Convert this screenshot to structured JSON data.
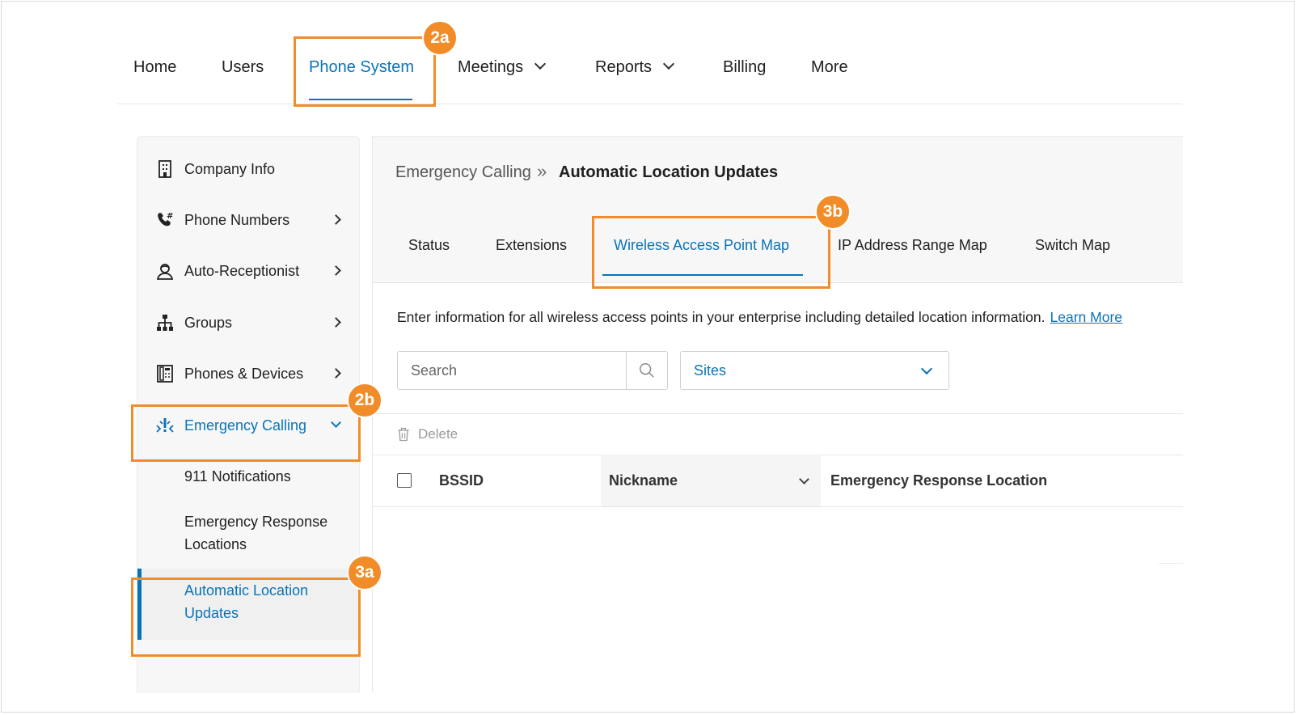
{
  "topnav": {
    "items": [
      "Home",
      "Users",
      "Phone System",
      "Meetings",
      "Reports",
      "Billing",
      "More"
    ],
    "active": "Phone System"
  },
  "sidebar": {
    "items": [
      {
        "label": "Company Info",
        "icon": "building-icon"
      },
      {
        "label": "Phone Numbers",
        "icon": "phone-hash-icon"
      },
      {
        "label": "Auto-Receptionist",
        "icon": "receptionist-icon"
      },
      {
        "label": "Groups",
        "icon": "org-chart-icon"
      },
      {
        "label": "Phones & Devices",
        "icon": "desk-phone-icon"
      },
      {
        "label": "Emergency Calling",
        "icon": "emergency-icon"
      }
    ],
    "subitems": [
      "911 Notifications",
      "Emergency Response Locations",
      "Automatic Location Updates"
    ]
  },
  "breadcrumb": {
    "parent": "Emergency Calling",
    "separator": "»",
    "current": "Automatic Location Updates"
  },
  "tabs": [
    "Status",
    "Extensions",
    "Wireless Access Point Map",
    "IP Address Range Map",
    "Switch Map"
  ],
  "active_tab": "Wireless Access Point Map",
  "description": "Enter information for all wireless access points in your enterprise including detailed location information.",
  "learn_more": "Learn More",
  "search": {
    "placeholder": "Search"
  },
  "sites": {
    "value": "Sites"
  },
  "toolbar": {
    "delete_label": "Delete"
  },
  "table": {
    "columns": [
      "BSSID",
      "Nickname",
      "Emergency Response Location"
    ]
  },
  "annotations": {
    "a2a": "2a",
    "a2b": "2b",
    "a3a": "3a",
    "a3b": "3b"
  },
  "colors": {
    "accent": "#0a73b8",
    "highlight": "#f28c28"
  }
}
